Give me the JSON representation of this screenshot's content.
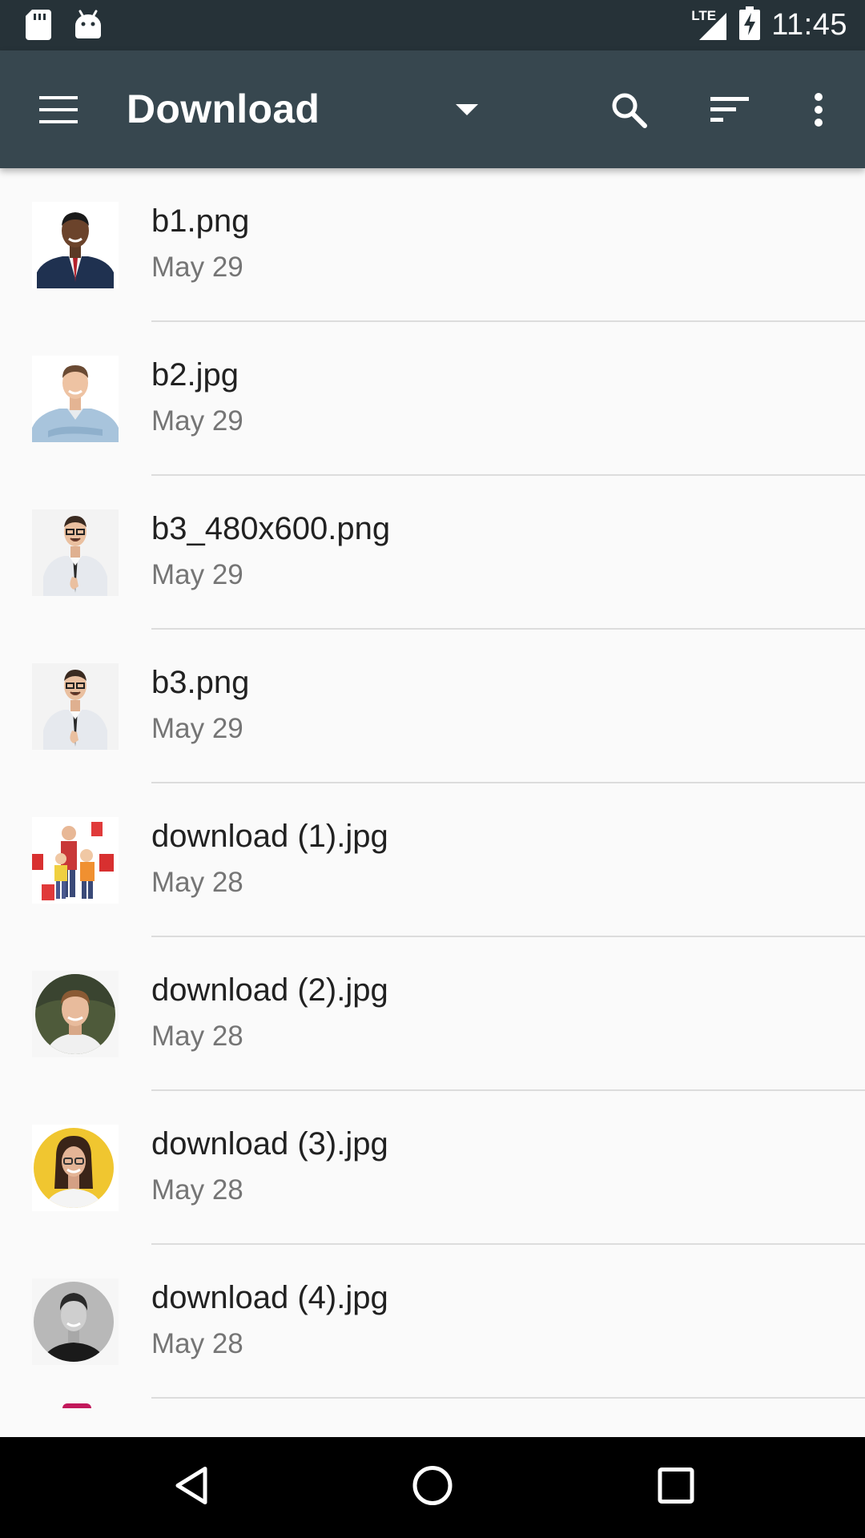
{
  "status_bar": {
    "time": "11:45",
    "network": "LTE",
    "left_icons": [
      "sd-card-icon",
      "android-icon"
    ],
    "right_icons": [
      "signal-icon",
      "battery-charging-icon"
    ]
  },
  "app_bar": {
    "title": "Download",
    "icons": [
      "menu-icon",
      "dropdown-arrow-icon",
      "search-icon",
      "sort-icon",
      "more-vert-icon"
    ],
    "background": "#37474f"
  },
  "files": [
    {
      "name": "b1.png",
      "date": "May 29",
      "thumb": "portrait-dark-suit"
    },
    {
      "name": "b2.jpg",
      "date": "May 29",
      "thumb": "portrait-denim-shirt"
    },
    {
      "name": "b3_480x600.png",
      "date": "May 29",
      "thumb": "portrait-thumbs-up"
    },
    {
      "name": "b3.png",
      "date": "May 29",
      "thumb": "portrait-thumbs-up"
    },
    {
      "name": "download (1).jpg",
      "date": "May 28",
      "thumb": "family-shopping-bags"
    },
    {
      "name": "download (2).jpg",
      "date": "May 28",
      "thumb": "round-avatar-man-green"
    },
    {
      "name": "download (3).jpg",
      "date": "May 28",
      "thumb": "round-avatar-woman-yellow"
    },
    {
      "name": "download (4).jpg",
      "date": "May 28",
      "thumb": "round-avatar-man-bw"
    }
  ],
  "nav_bar": {
    "icons": [
      "back-icon",
      "home-icon",
      "recents-icon"
    ]
  },
  "colors": {
    "status_bar": "#263238",
    "app_bar": "#37474f",
    "list_bg": "#fafafa",
    "primary_text": "#212121",
    "secondary_text": "#757575"
  }
}
